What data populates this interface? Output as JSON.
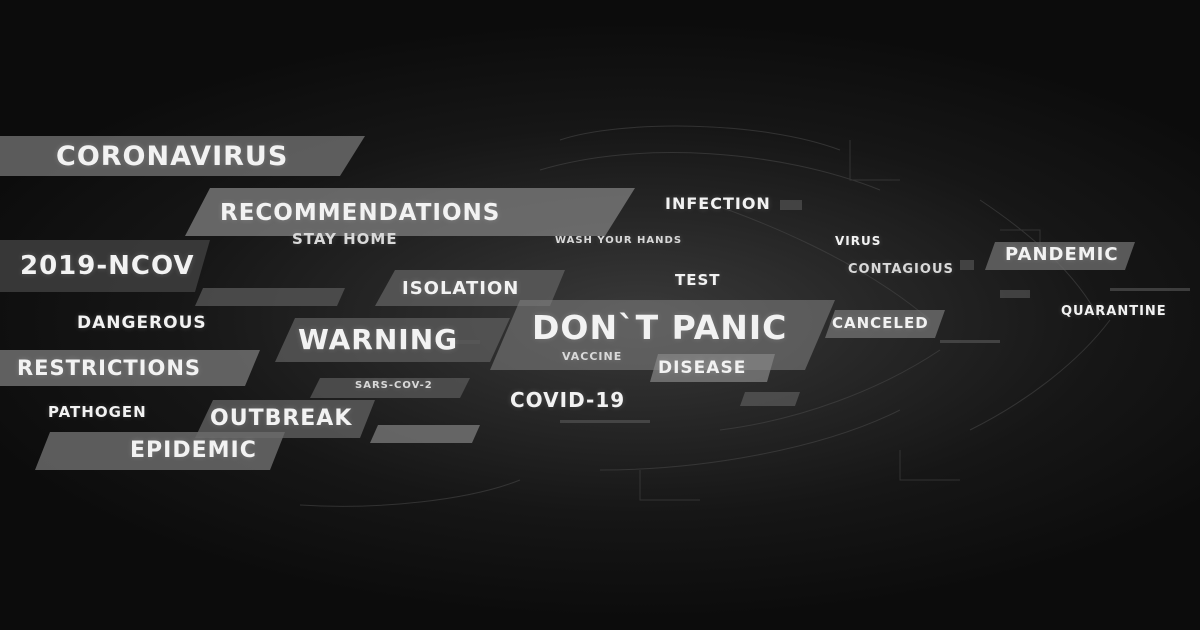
{
  "words": {
    "coronavirus": "CORONAVIRUS",
    "recommendations": "RECOMMENDATIONS",
    "infection": "INFECTION",
    "stay_home": "STAY HOME",
    "wash_your_hands": "WASH YOUR HANDS",
    "virus": "VIRUS",
    "pandemic": "PANDEMIC",
    "ncov": "2019-NCOV",
    "isolation": "ISOLATION",
    "test": "TEST",
    "contagious": "CONTAGIOUS",
    "dangerous": "DANGEROUS",
    "warning": "WARNING",
    "dont_panic": "DON`T PANIC",
    "canceled": "CANCELED",
    "quarantine": "QUARANTINE",
    "vaccine": "VACCINE",
    "restrictions": "RESTRICTIONS",
    "disease": "DISEASE",
    "sars_cov2": "SARS-COV-2",
    "covid19": "COVID-19",
    "pathogen": "PATHOGEN",
    "outbreak": "OUTBREAK",
    "epidemic": "EPIDEMIC"
  },
  "theme": {
    "background": "#0b0b0b",
    "band": "#6a6a6a",
    "text": "#f2f2f2"
  }
}
